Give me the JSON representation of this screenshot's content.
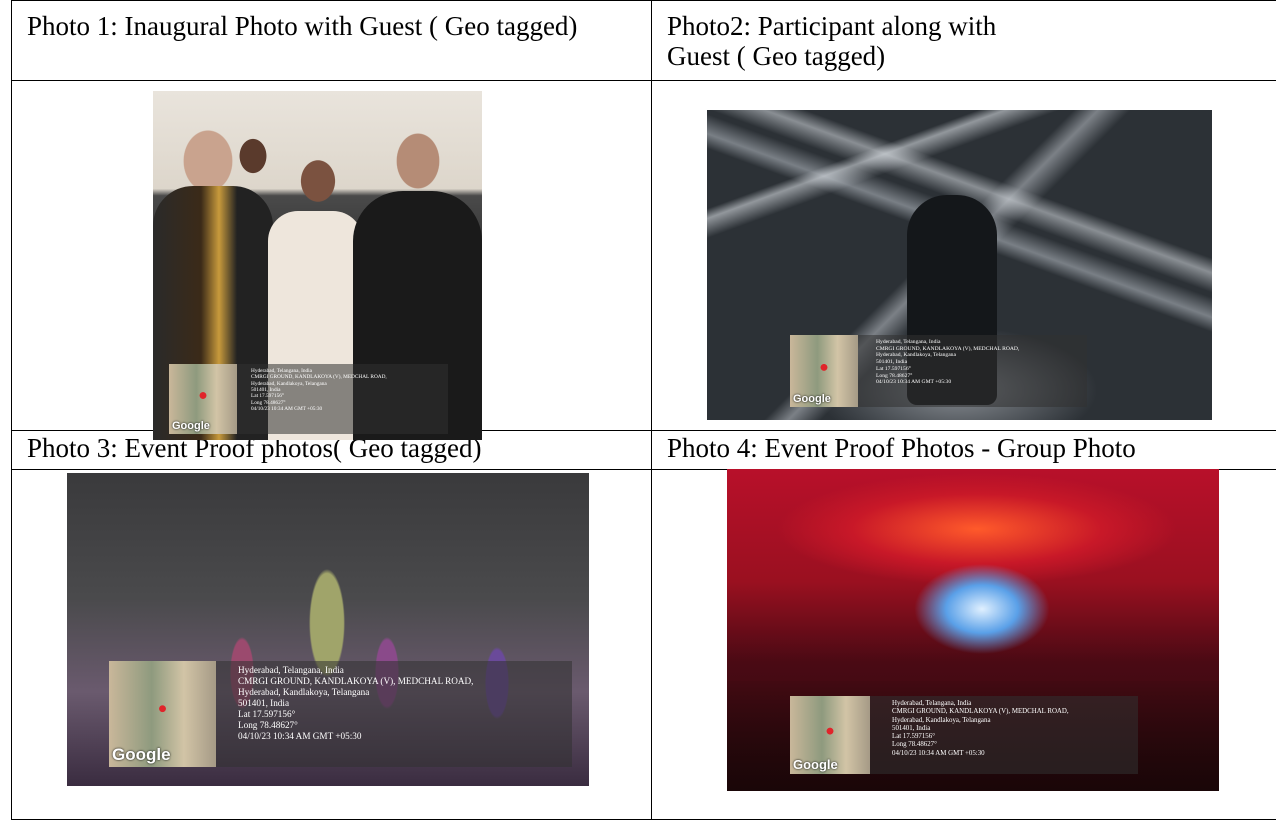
{
  "captions": {
    "photo1": "Photo 1: Inaugural Photo with Guest ( Geo tagged)",
    "photo2_line1": "Photo2: Participant along with",
    "photo2_line2": "Guest ( Geo tagged)",
    "photo3": "Photo 3: Event Proof photos( Geo tagged)",
    "photo4": "Photo 4: Event Proof Photos - Group Photo"
  },
  "geotag": {
    "map_label": "Google",
    "lines": [
      "Hyderabad, Telangana, India",
      "CMRGI GROUND, KANDLAKOYA (V), MEDCHAL ROAD,",
      "Hyderabad, Kandlakoya, Telangana",
      "501401, India",
      "Lat 17.597156°",
      "Long 78.48627°",
      "04/10/23 10:34 AM GMT +05:30"
    ]
  },
  "colors": {
    "border": "#000000",
    "geotag_bg": "rgba(50,50,50,0.55)",
    "pin": "#e0242a"
  },
  "icons": {
    "map_pin": "map-pin-icon"
  }
}
